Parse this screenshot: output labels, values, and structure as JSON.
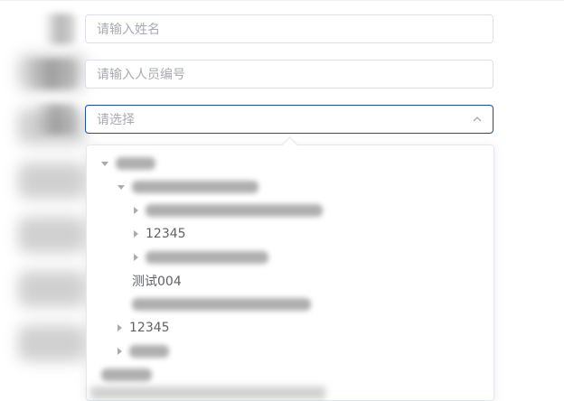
{
  "form": {
    "name_placeholder": "请输入姓名",
    "number_placeholder": "请输入人员编号",
    "select_placeholder": "请选择"
  },
  "tree": {
    "visible_labels": {
      "a": "12345",
      "b": "测试004",
      "c": "12345"
    }
  },
  "icons": {
    "select_caret": "chevron-up-icon",
    "node_toggle": "triangle-icon"
  },
  "colors": {
    "active_border": "#1f4e9e",
    "border": "#dcdfe6",
    "placeholder": "#a8abb2",
    "text": "#606266"
  }
}
